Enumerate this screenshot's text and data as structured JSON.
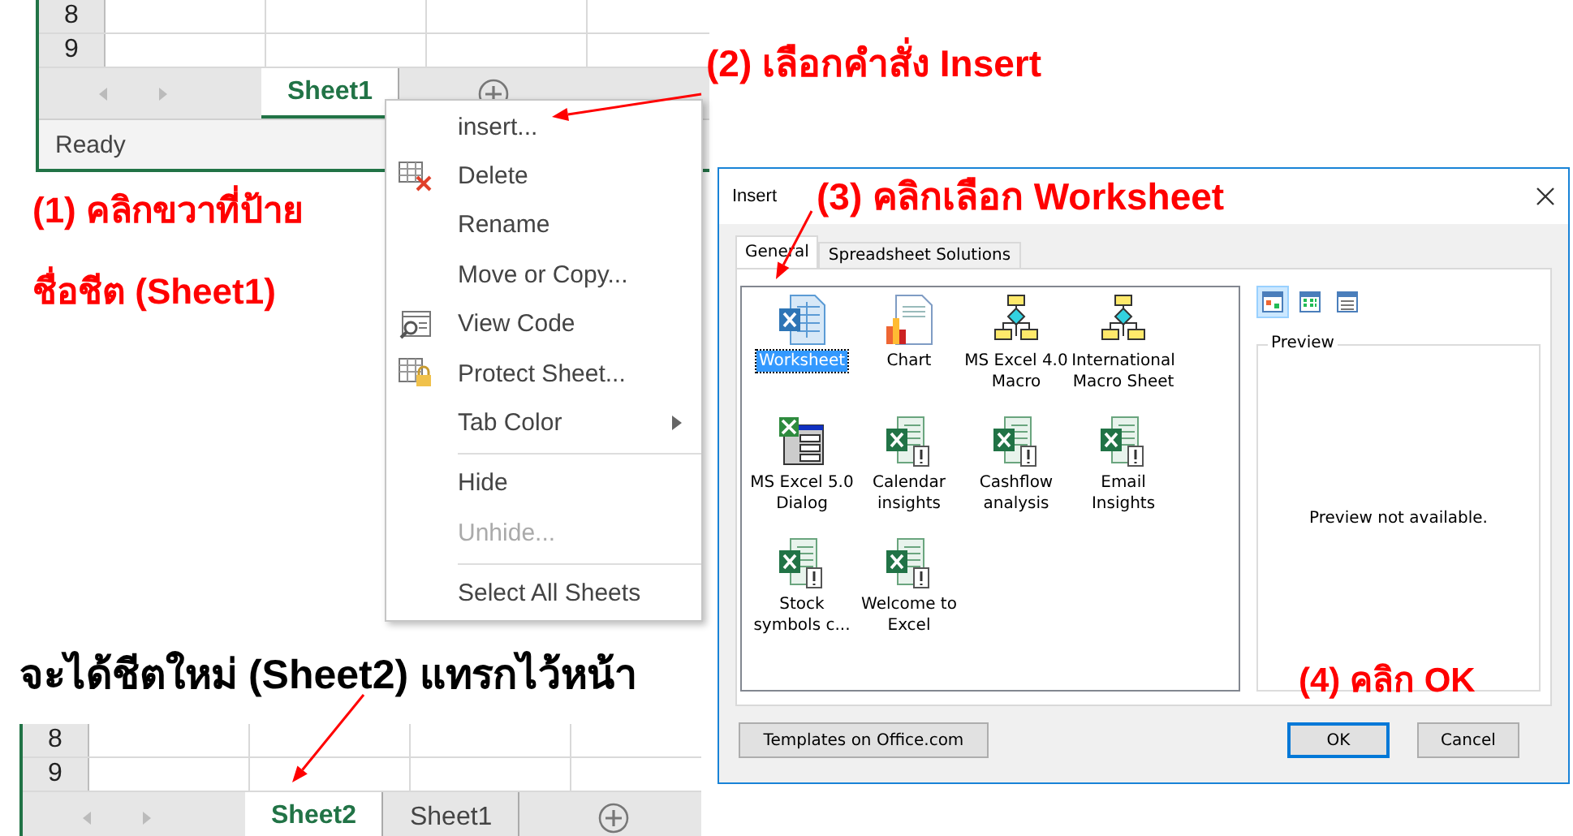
{
  "top_sheet": {
    "rows": [
      "8",
      "9"
    ],
    "sheet_tabs": [
      {
        "label": "Sheet1",
        "selected": true
      }
    ],
    "status_bar": "Ready"
  },
  "context_menu": {
    "items": [
      {
        "kind": "item",
        "label": "insert...",
        "disabled": false,
        "submenu": false
      },
      {
        "kind": "item",
        "label": "Delete",
        "disabled": false,
        "submenu": false
      },
      {
        "kind": "item",
        "label": "Rename",
        "disabled": false,
        "submenu": false
      },
      {
        "kind": "item",
        "label": "Move or Copy...",
        "disabled": false,
        "submenu": false
      },
      {
        "kind": "item",
        "label": "View Code",
        "disabled": false,
        "submenu": false
      },
      {
        "kind": "item",
        "label": "Protect Sheet...",
        "disabled": false,
        "submenu": false
      },
      {
        "kind": "item",
        "label": "Tab Color",
        "disabled": false,
        "submenu": true
      },
      {
        "kind": "separator"
      },
      {
        "kind": "item",
        "label": "Hide",
        "disabled": false,
        "submenu": false
      },
      {
        "kind": "item",
        "label": "Unhide...",
        "disabled": true,
        "submenu": false
      },
      {
        "kind": "separator"
      },
      {
        "kind": "item",
        "label": "Select All Sheets",
        "disabled": false,
        "submenu": false
      }
    ]
  },
  "dialog": {
    "title": "Insert",
    "tabs": [
      {
        "label": "General",
        "selected": true
      },
      {
        "label": "Spreadsheet Solutions",
        "selected": false
      }
    ],
    "items": [
      {
        "kind": "worksheet",
        "label": "Worksheet",
        "selected": true
      },
      {
        "kind": "chart",
        "label": "Chart",
        "selected": false
      },
      {
        "kind": "macro",
        "label": "MS Excel 4.0 Macro",
        "selected": false
      },
      {
        "kind": "macro",
        "label": "International Macro Sheet",
        "selected": false
      },
      {
        "kind": "dialog",
        "label": "MS Excel 5.0 Dialog",
        "selected": false
      },
      {
        "kind": "template",
        "label": "Calendar insights",
        "selected": false
      },
      {
        "kind": "template",
        "label": "Cashflow analysis",
        "selected": false
      },
      {
        "kind": "template",
        "label": "Email Insights",
        "selected": false
      },
      {
        "kind": "template",
        "label": "Stock symbols c...",
        "selected": false
      },
      {
        "kind": "template",
        "label": "Welcome to Excel",
        "selected": false
      }
    ],
    "view_buttons": [
      {
        "selected": true
      },
      {
        "selected": false
      },
      {
        "selected": false
      }
    ],
    "preview_label": "Preview",
    "preview_text": "Preview not available.",
    "buttons": [
      {
        "label": "Templates on Office.com",
        "default": false
      },
      {
        "label": "OK",
        "default": true
      },
      {
        "label": "Cancel",
        "default": false
      }
    ]
  },
  "annotations": [
    {
      "text": "(2) เลือกคำสั่ง Insert",
      "color": "#ff0000"
    },
    {
      "text": "(1) คลิกขวาที่ป้าย",
      "color": "#ff0000"
    },
    {
      "text": "ชื่อชีต (Sheet1)",
      "color": "#ff0000"
    },
    {
      "text": "(3) คลิกเลือก Worksheet",
      "color": "#ff0000"
    },
    {
      "text": "(4) คลิก OK",
      "color": "#ff0000"
    },
    {
      "text": "จะได้ชีตใหม่ (Sheet2) แทรกไว้หน้า",
      "color": "#000000"
    }
  ],
  "bottom_sheet": {
    "rows": [
      "8",
      "9"
    ],
    "sheet_tabs": [
      {
        "label": "Sheet2",
        "selected": true
      },
      {
        "label": "Sheet1",
        "selected": false
      }
    ]
  }
}
